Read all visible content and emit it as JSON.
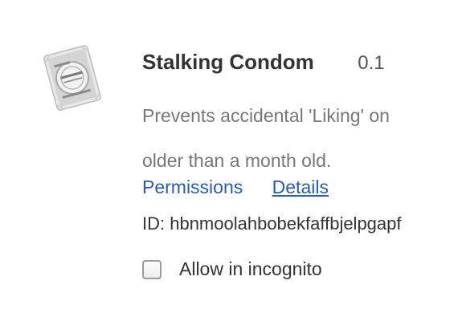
{
  "extension": {
    "name": "Stalking Condom",
    "version": "0.1",
    "description_lines": [
      "Prevents accidental 'Liking' on",
      "older than a month old."
    ],
    "links": {
      "permissions": "Permissions",
      "details": "Details"
    },
    "id_text": "ID: hbnmoolahbobekfaffbjelpgapf",
    "incognito": {
      "label": "Allow in incognito",
      "checked": false
    },
    "icon": "condom-package-icon"
  },
  "colors": {
    "link": "#2a5db0",
    "title": "#333333",
    "description": "#777777"
  }
}
